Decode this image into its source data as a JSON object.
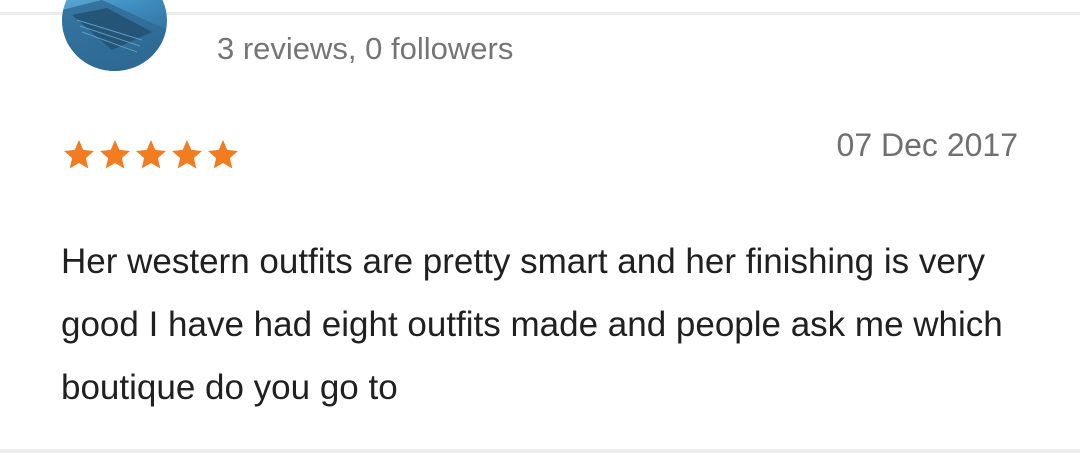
{
  "reviewer": {
    "avatar_icon": "user-avatar-photo",
    "stats": "3 reviews,  0 followers"
  },
  "review": {
    "rating": 5,
    "rating_max": 5,
    "star_color": "#f47c20",
    "date": "07 Dec 2017",
    "text": "Her western outfits are pretty smart and her finishing is very good I have had eight outfits made and people ask me which boutique do you go to"
  }
}
